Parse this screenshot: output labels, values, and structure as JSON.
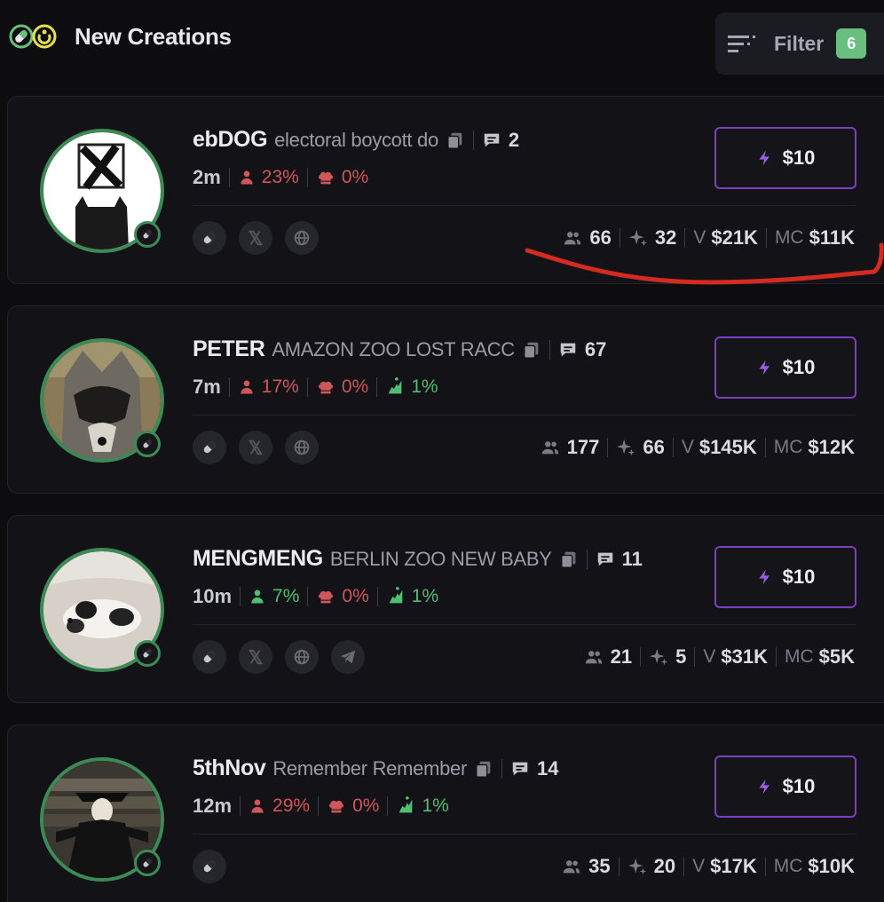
{
  "header": {
    "title": "New Creations",
    "filter_label": "Filter",
    "filter_count": "6"
  },
  "colors": {
    "accent_purple": "#7b3fc4",
    "positive_green": "#4fbf72",
    "negative_red": "#d0565a",
    "badge_green": "#6bbf7e",
    "annotation_red": "#d42a20"
  },
  "coins": [
    {
      "name": "ebDOG",
      "description": "electoral boycott do",
      "replies": "2",
      "age": "2m",
      "holders_pct": "23%",
      "holders_color": "red",
      "dev_pct": "0%",
      "snipers_pct": null,
      "socials": [
        "pill-icon",
        "x-icon",
        "globe-icon"
      ],
      "holders": "66",
      "txns": "32",
      "volume_label": "V",
      "volume": "$21K",
      "mc_label": "MC",
      "market_cap": "$11K",
      "buy_label": "$10"
    },
    {
      "name": "PETER",
      "description": "AMAZON ZOO LOST RACC",
      "replies": "67",
      "age": "7m",
      "holders_pct": "17%",
      "holders_color": "red",
      "dev_pct": "0%",
      "snipers_pct": "1%",
      "socials": [
        "pill-icon",
        "x-icon",
        "globe-icon"
      ],
      "holders": "177",
      "txns": "66",
      "volume_label": "V",
      "volume": "$145K",
      "mc_label": "MC",
      "market_cap": "$12K",
      "buy_label": "$10"
    },
    {
      "name": "MENGMENG",
      "description": "BERLIN ZOO NEW BABY",
      "replies": "11",
      "age": "10m",
      "holders_pct": "7%",
      "holders_color": "green",
      "dev_pct": "0%",
      "snipers_pct": "1%",
      "socials": [
        "pill-icon",
        "x-icon",
        "globe-icon",
        "telegram-icon"
      ],
      "holders": "21",
      "txns": "5",
      "volume_label": "V",
      "volume": "$31K",
      "mc_label": "MC",
      "market_cap": "$5K",
      "buy_label": "$10"
    },
    {
      "name": "5thNov",
      "description": "Remember Remember",
      "replies": "14",
      "age": "12m",
      "holders_pct": "29%",
      "holders_color": "red",
      "dev_pct": "0%",
      "snipers_pct": "1%",
      "socials": [
        "pill-icon"
      ],
      "holders": "35",
      "txns": "20",
      "volume_label": "V",
      "volume": "$17K",
      "mc_label": "MC",
      "market_cap": "$10K",
      "buy_label": "$10"
    }
  ]
}
